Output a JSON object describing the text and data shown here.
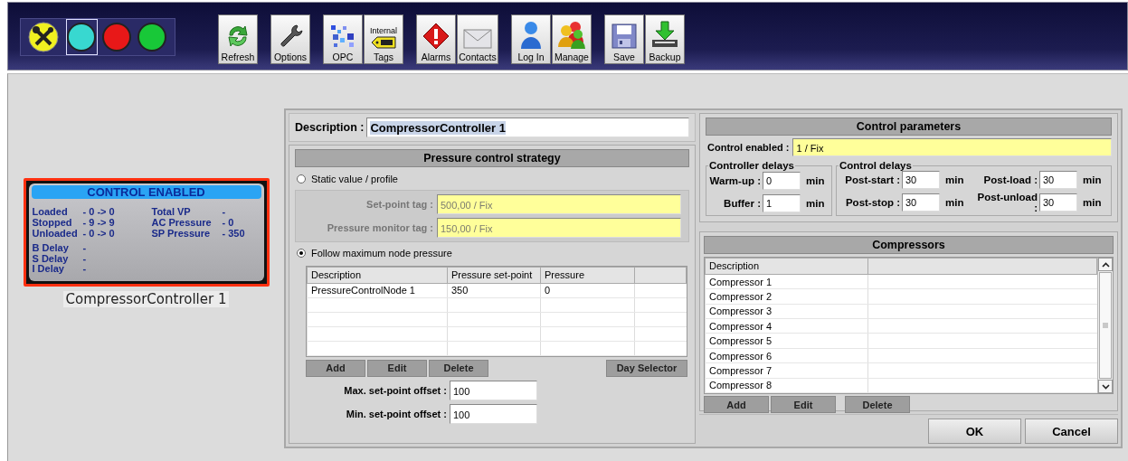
{
  "toolbar": {
    "status_lights": [
      {
        "color": "#38d8d0",
        "selected": true
      },
      {
        "color": "#e81818",
        "selected": false
      },
      {
        "color": "#18c838",
        "selected": false
      }
    ],
    "button_groups": [
      {
        "buttons": [
          {
            "kind": "refresh",
            "label": "Refresh"
          }
        ]
      },
      {
        "buttons": [
          {
            "kind": "options",
            "label": "Options"
          }
        ]
      },
      {
        "buttons": [
          {
            "kind": "opc",
            "label": "OPC"
          },
          {
            "kind": "tags",
            "label": "Tags",
            "top_label": "Internal"
          }
        ]
      },
      {
        "buttons": [
          {
            "kind": "alarms",
            "label": "Alarms"
          },
          {
            "kind": "contacts",
            "label": "Contacts"
          }
        ]
      },
      {
        "buttons": [
          {
            "kind": "login",
            "label": "Log In"
          },
          {
            "kind": "manage",
            "label": "Manage"
          }
        ]
      },
      {
        "buttons": [
          {
            "kind": "save",
            "label": "Save"
          },
          {
            "kind": "backup",
            "label": "Backup"
          }
        ]
      }
    ]
  },
  "controller_card": {
    "title": "CONTROL ENABLED",
    "stats": [
      {
        "label": "Loaded",
        "value": "- 0 -> 0"
      },
      {
        "label": "Total VP",
        "value": "-"
      },
      {
        "label": "Stopped",
        "value": "- 9 -> 9"
      },
      {
        "label": "AC Pressure",
        "value": "- 0"
      },
      {
        "label": "Unloaded",
        "value": "- 0 -> 0"
      },
      {
        "label": "SP Pressure",
        "value": "- 350"
      }
    ],
    "delays": [
      {
        "label": "B Delay",
        "value": "-"
      },
      {
        "label": "S Delay",
        "value": "-"
      },
      {
        "label": "I Delay",
        "value": "-"
      }
    ],
    "name": "CompressorController 1"
  },
  "dialog": {
    "description": {
      "label": "Description :",
      "value": "CompressorController 1"
    },
    "pressure_strategy": {
      "title": "Pressure control strategy",
      "static_option": {
        "label": "Static value / profile",
        "selected": false
      },
      "tag_fields": [
        {
          "label": "Set-point tag :",
          "value": "500,00 / Fix",
          "disabled": true
        },
        {
          "label": "Pressure monitor tag :",
          "value": "150,00 / Fix",
          "disabled": true
        }
      ],
      "follow_option": {
        "label": "Follow maximum node pressure",
        "selected": true
      },
      "table": {
        "columns": [
          "Description",
          "Pressure set-point",
          "Pressure"
        ],
        "rows": [
          [
            "PressureControlNode 1",
            "350",
            "0"
          ]
        ]
      },
      "buttons": [
        "Add",
        "Edit",
        "Delete"
      ],
      "day_selector": "Day Selector",
      "offsets": [
        {
          "label": "Max. set-point offset :",
          "value": "100"
        },
        {
          "label": "Min. set-point offset :",
          "value": "100"
        }
      ]
    },
    "control_parameters": {
      "title": "Control parameters",
      "control_enabled": {
        "label": "Control enabled :",
        "value": "1 / Fix"
      },
      "controller_delays": {
        "title": "Controller delays",
        "fields": [
          {
            "label": "Warm-up :",
            "value": "0",
            "unit": "min"
          },
          {
            "label": "Buffer :",
            "value": "1",
            "unit": "min"
          }
        ]
      },
      "control_delays": {
        "title": "Control delays",
        "fields": [
          {
            "label": "Post-start :",
            "value": "30",
            "unit": "min"
          },
          {
            "label": "Post-load :",
            "value": "30",
            "unit": "min"
          },
          {
            "label": "Post-stop :",
            "value": "30",
            "unit": "min"
          },
          {
            "label": "Post-unload :",
            "value": "30",
            "unit": "min"
          }
        ]
      }
    },
    "compressors": {
      "title": "Compressors",
      "columns": [
        "Description"
      ],
      "rows": [
        "Compressor 1",
        "Compressor 2",
        "Compressor 3",
        "Compressor 4",
        "Compressor 5",
        "Compressor 6",
        "Compressor 7",
        "Compressor 8"
      ],
      "buttons": [
        "Add",
        "Edit",
        "Delete"
      ]
    },
    "buttons": [
      "OK",
      "Cancel"
    ]
  }
}
